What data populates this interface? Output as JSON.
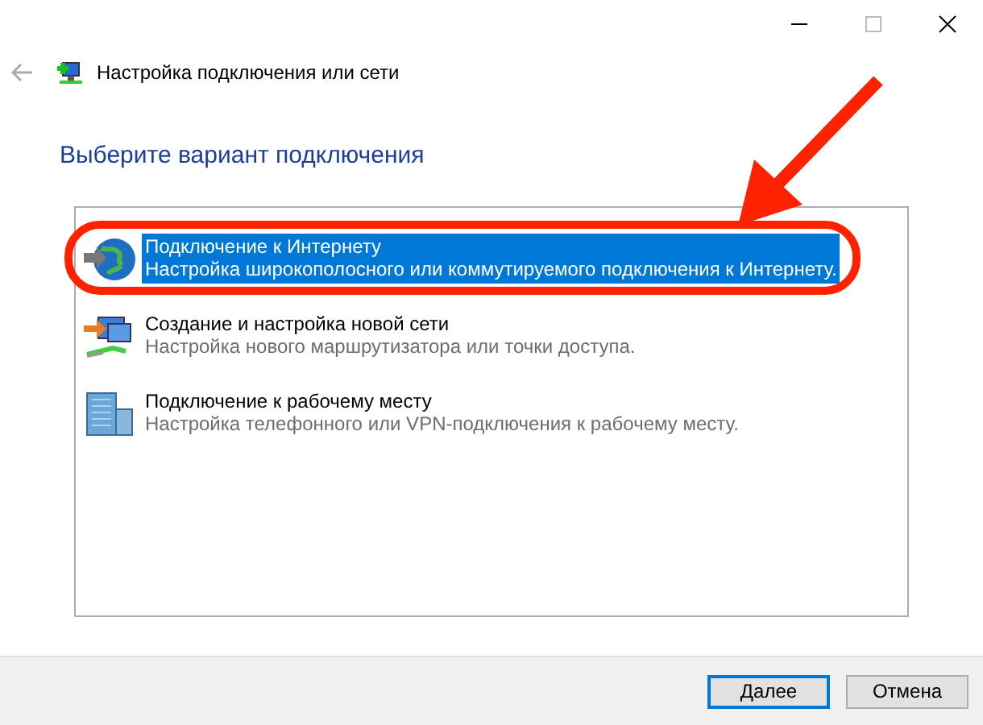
{
  "window": {
    "title": "Настройка подключения или сети"
  },
  "heading": "Выберите вариант подключения",
  "options": [
    {
      "title": "Подключение к Интернету",
      "description": "Настройка широкополосного или коммутируемого подключения к Интернету.",
      "selected": true
    },
    {
      "title": "Создание и настройка новой сети",
      "description": "Настройка нового маршрутизатора или точки доступа.",
      "selected": false
    },
    {
      "title": "Подключение к рабочему месту",
      "description": "Настройка телефонного или VPN-подключения к рабочему месту.",
      "selected": false
    }
  ],
  "buttons": [
    {
      "label": "Далее",
      "default": true
    },
    {
      "label": "Отмена",
      "default": false
    }
  ]
}
